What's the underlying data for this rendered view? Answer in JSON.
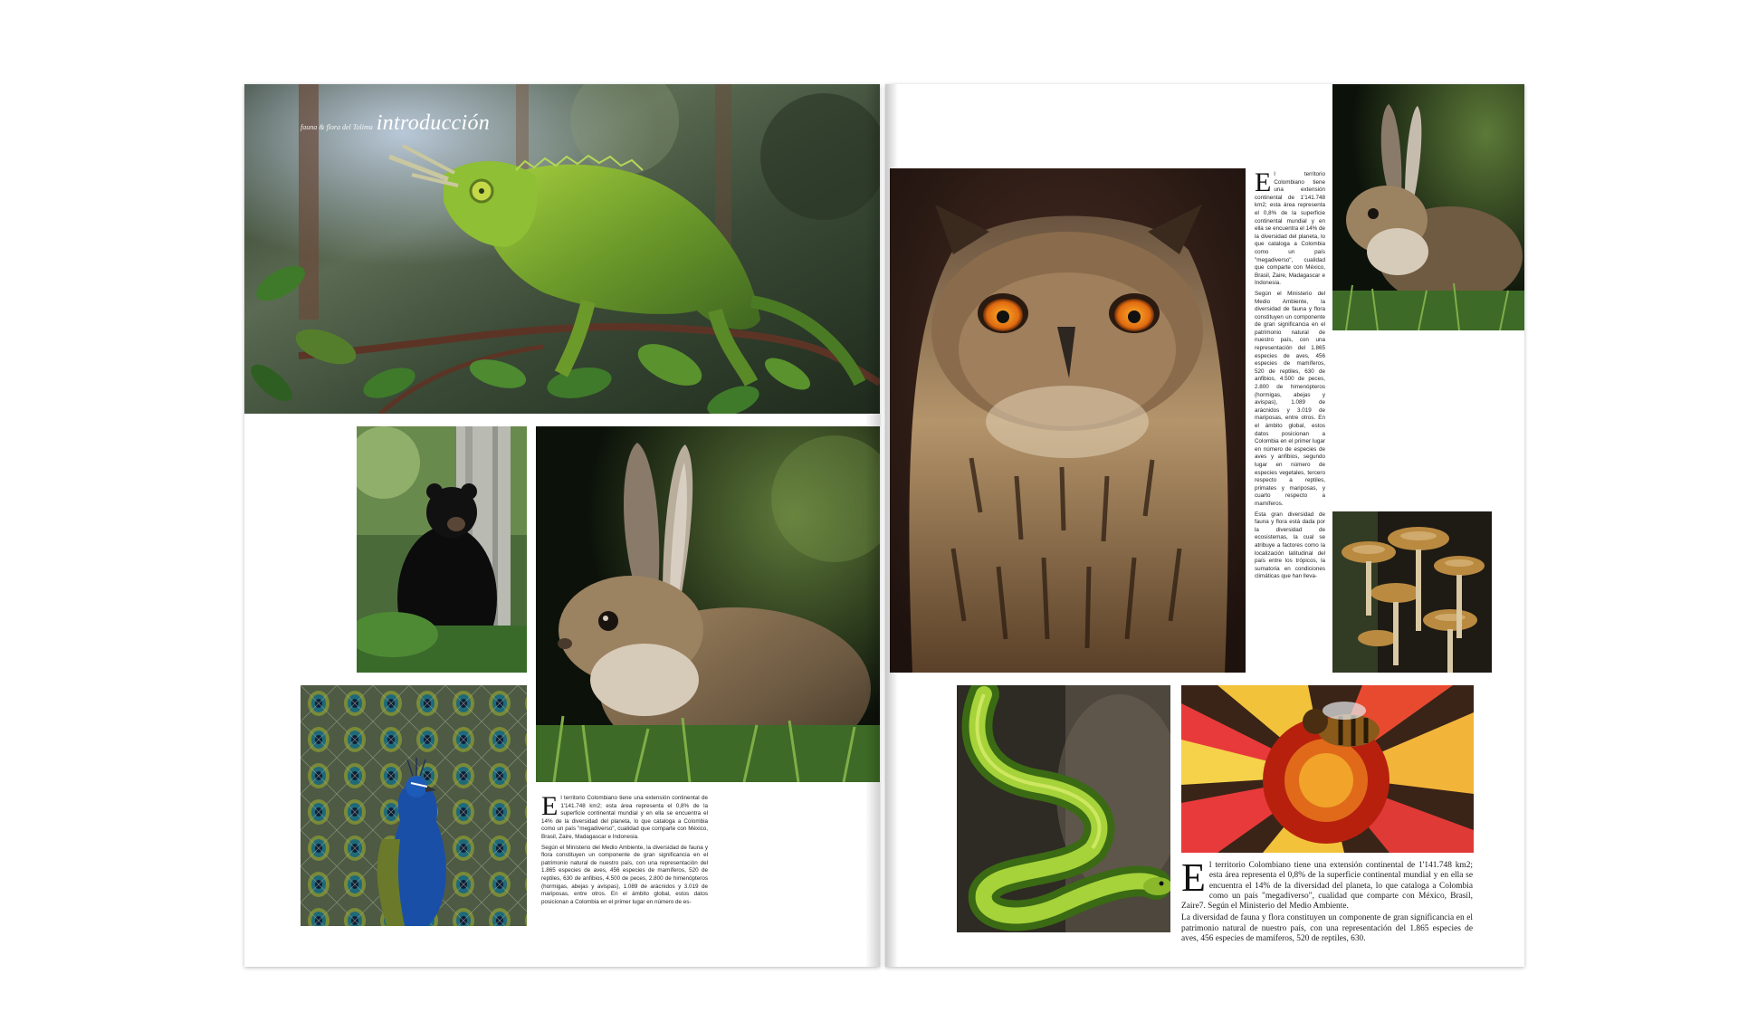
{
  "header": {
    "section": "fauna & flora del Tolima",
    "title": "introducción"
  },
  "left_page": {
    "body": {
      "dropcap": "E",
      "paragraphs": [
        "l territorio Colombiano tiene una extensión continental de 1'141.748 km2; esta área representa el 0,8% de la superficie continental mundial y en ella se encuentra el 14% de la diversidad del planeta, lo que cataloga a Colombia como un país \"megadiverso\", cualidad que comparte con México, Brasil, Zaire, Madagascar e Indonesia.",
        "Según el Ministerio del Medio Ambiente, la diversidad de fauna y flora constituyen un componente de gran significancia en el patrimonio natural de nuestro país, con una representación del 1.865 especies de aves, 456 especies de mamíferos, 520 de reptiles, 630 de anfibios, 4.500 de peces, 2.800 de himenópteros (hormigas, abejas y avispas), 1.089 de arácnidos y 3.019 de mariposas, entre otros. En el ámbito global, estos datos posicionan a Colombia en el primer lugar en número de es-"
      ]
    }
  },
  "right_page": {
    "column": {
      "dropcap": "E",
      "paragraphs": [
        "l territorio Colombiano tiene una extensión continental de 1'141.748 km2; esta área representa el 0,8% de la superficie continental mundial y en ella se encuentra el 14% de la diversidad del planeta, lo que cataloga a Colombia como un país \"megadiverso\", cualidad que comparte con México, Brasil, Zaire, Madagascar e Indonesia.",
        "Según el Ministerio del Medio Ambiente, la diversidad de fauna y flora constituyen un componente de gran significancia en el patrimonio natural de nuestro país, con una representación del 1.865 especies de aves, 456 especies de mamíferos, 520 de reptiles, 630 de anfibios, 4.500 de peces, 2.800 de himenópteros (hormigas, abejas y avispas), 1.089 de arácnidos y 3.019 de mariposas, entre otros. En el ámbito global, estos datos posicionan a Colombia en el primer lugar en número de especies de aves y anfibios, segundo lugar en número de especies vegetales, tercero respecto a reptiles, primates y mariposas, y cuarto respecto a mamíferos.",
        "Esta gran diversidad de fauna y flora está dada por la diversidad de ecosistemas, la cual se atribuye a factores como la localización latitudinal del país entre los trópicos, la sumatoria en condiciones climáticas que han lleva-"
      ]
    },
    "bottom": {
      "dropcap": "E",
      "paragraphs": [
        "l territorio Colombiano tiene una extensión continental de 1'141.748 km2; esta área representa el 0,8% de la superficie continental mundial y en ella se encuentra el 14% de la diversidad del planeta, lo que cataloga a Colombia como un país \"megadiverso\", cualidad que comparte con México, Brasil, Zaire7. Según el Ministerio del Medio Ambiente.",
        "La diversidad de fauna y flora constituyen un componente de gran significancia en el patrimonio natural de nuestro país, con una representación del 1.865 especies de aves, 456 especies de mamíferos, 520 de reptiles, 630."
      ]
    }
  }
}
